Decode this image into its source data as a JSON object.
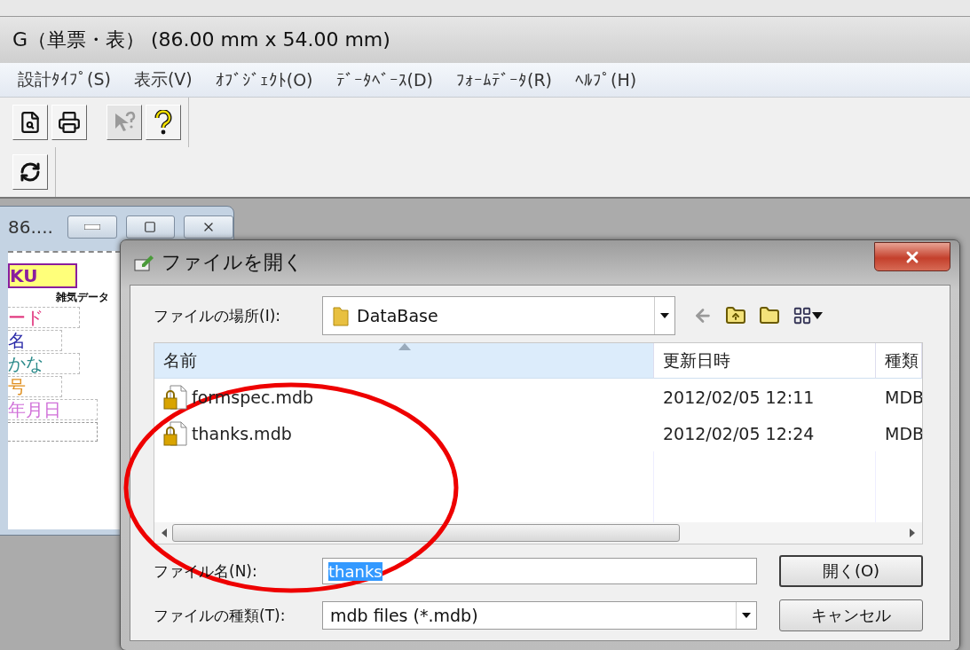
{
  "app": {
    "title": "G（単票・表） (86.00 mm x 54.00 mm)"
  },
  "menu": [
    {
      "label": "設計ﾀｲﾌﾟ(S)"
    },
    {
      "label": "表示(V)"
    },
    {
      "label": "ｵﾌﾞｼﾞｪｸﾄ(O)"
    },
    {
      "label": "ﾃﾞｰﾀﾍﾞｰｽ(D)"
    },
    {
      "label": "ﾌｫｰﾑﾃﾞｰﾀ(R)"
    },
    {
      "label": "ﾍﾙﾌﾟ(H)"
    }
  ],
  "toolbar_rows": [
    [
      {
        "kind": "preview",
        "disabled": false
      },
      {
        "kind": "print",
        "disabled": false
      },
      {
        "kind": "whats-this",
        "disabled": true
      },
      {
        "kind": "help",
        "disabled": false
      }
    ],
    [
      {
        "kind": "refresh",
        "disabled": false
      }
    ]
  ],
  "child_window": {
    "title": "86....",
    "fields": [
      {
        "text": "KU",
        "kind": "boxed",
        "color": "#8a1e9e"
      },
      {
        "text": "雑気データ",
        "kind": "note",
        "color": "#111111"
      },
      {
        "text": "ード",
        "kind": "field",
        "color": "#e0307a"
      },
      {
        "text": "名",
        "kind": "field",
        "color": "#2a2aa8"
      },
      {
        "text": "かな",
        "kind": "field",
        "color": "#2a8a8a"
      },
      {
        "text": "号",
        "kind": "field",
        "color": "#e09020"
      },
      {
        "text": "年月日",
        "kind": "field",
        "color": "#d070d8"
      },
      {
        "kind": "blank",
        "color": "#999999"
      }
    ]
  },
  "dialog": {
    "title": "ファイルを開く",
    "location_label": "ファイルの場所(I):",
    "location": "DataBase",
    "columns": [
      "名前",
      "更新日時",
      "種類"
    ],
    "files": [
      {
        "name": "formspec.mdb",
        "modified": "2012/02/05 12:11",
        "type": "MDB"
      },
      {
        "name": "thanks.mdb",
        "modified": "2012/02/05 12:24",
        "type": "MDB"
      }
    ],
    "filename_label": "ファイル名(N):",
    "filename": {
      "value": "thanks",
      "selected": true
    },
    "filetype_label": "ファイルの種類(T):",
    "filetype": "mdb files (*.mdb)",
    "buttons": [
      {
        "label": "開く(O)",
        "default": true
      },
      {
        "label": "キャンセル",
        "default": false
      }
    ]
  }
}
